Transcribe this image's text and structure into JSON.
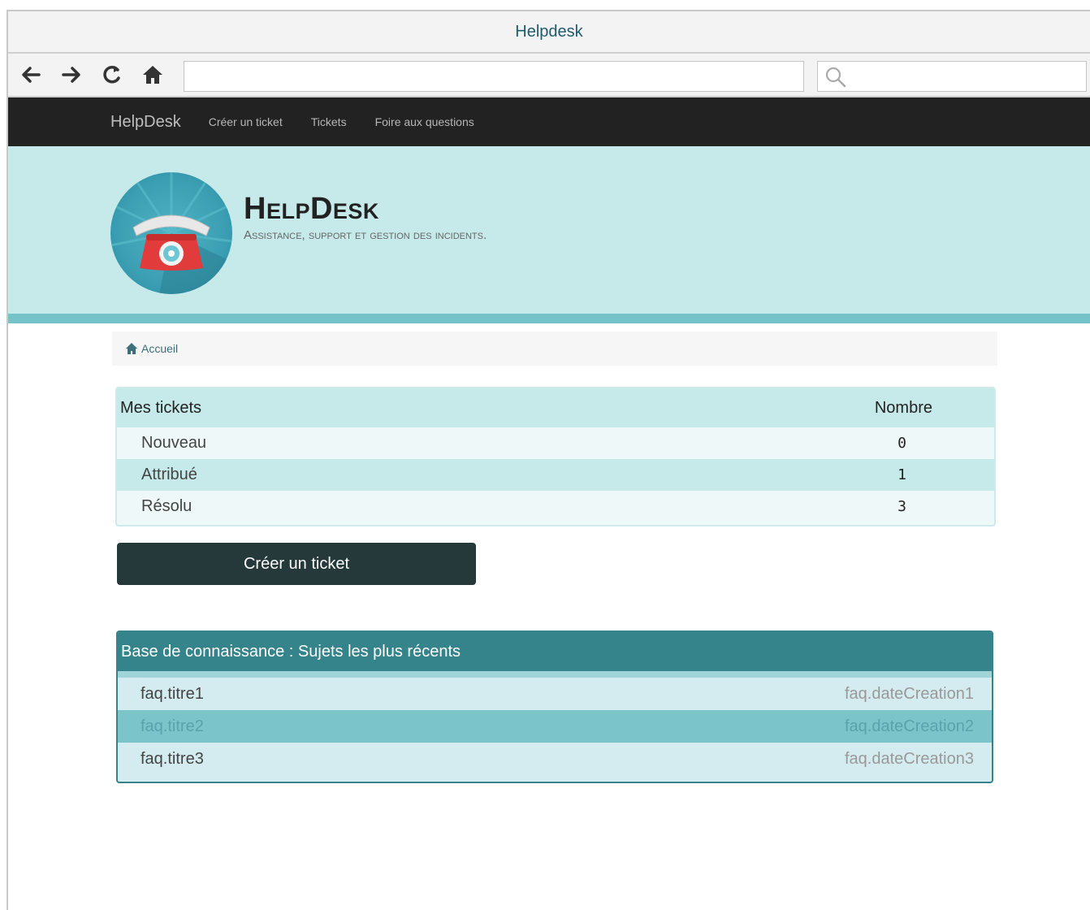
{
  "browser": {
    "title": "Helpdesk",
    "icons": [
      "back-arrow-icon",
      "forward-arrow-icon",
      "reload-icon",
      "home-icon",
      "search-icon"
    ]
  },
  "navbar": {
    "brand": "HelpDesk",
    "links": [
      "Créer un ticket",
      "Tickets",
      "Foire aux questions"
    ]
  },
  "hero": {
    "title": "HelpDesk",
    "subtitle": "Assistance, support et gestion des incidents."
  },
  "breadcrumb": {
    "home": "Accueil"
  },
  "tickets": {
    "header_label": "Mes tickets",
    "header_count": "Nombre",
    "rows": [
      {
        "label": "Nouveau",
        "count": "0"
      },
      {
        "label": "Attribué",
        "count": "1"
      },
      {
        "label": "Résolu",
        "count": "3"
      }
    ]
  },
  "actions": {
    "create_ticket": "Créer un ticket"
  },
  "faq": {
    "title": "Base de connaissance : Sujets les plus récents",
    "rows": [
      {
        "title": "faq.titre1",
        "date": "faq.dateCreation1"
      },
      {
        "title": "faq.titre2",
        "date": "faq.dateCreation2"
      },
      {
        "title": "faq.titre3",
        "date": "faq.dateCreation3"
      }
    ]
  },
  "colors": {
    "navbar": "#222222",
    "hero_bg": "#c6eaea",
    "accent": "#35848c",
    "button": "#25393b"
  }
}
